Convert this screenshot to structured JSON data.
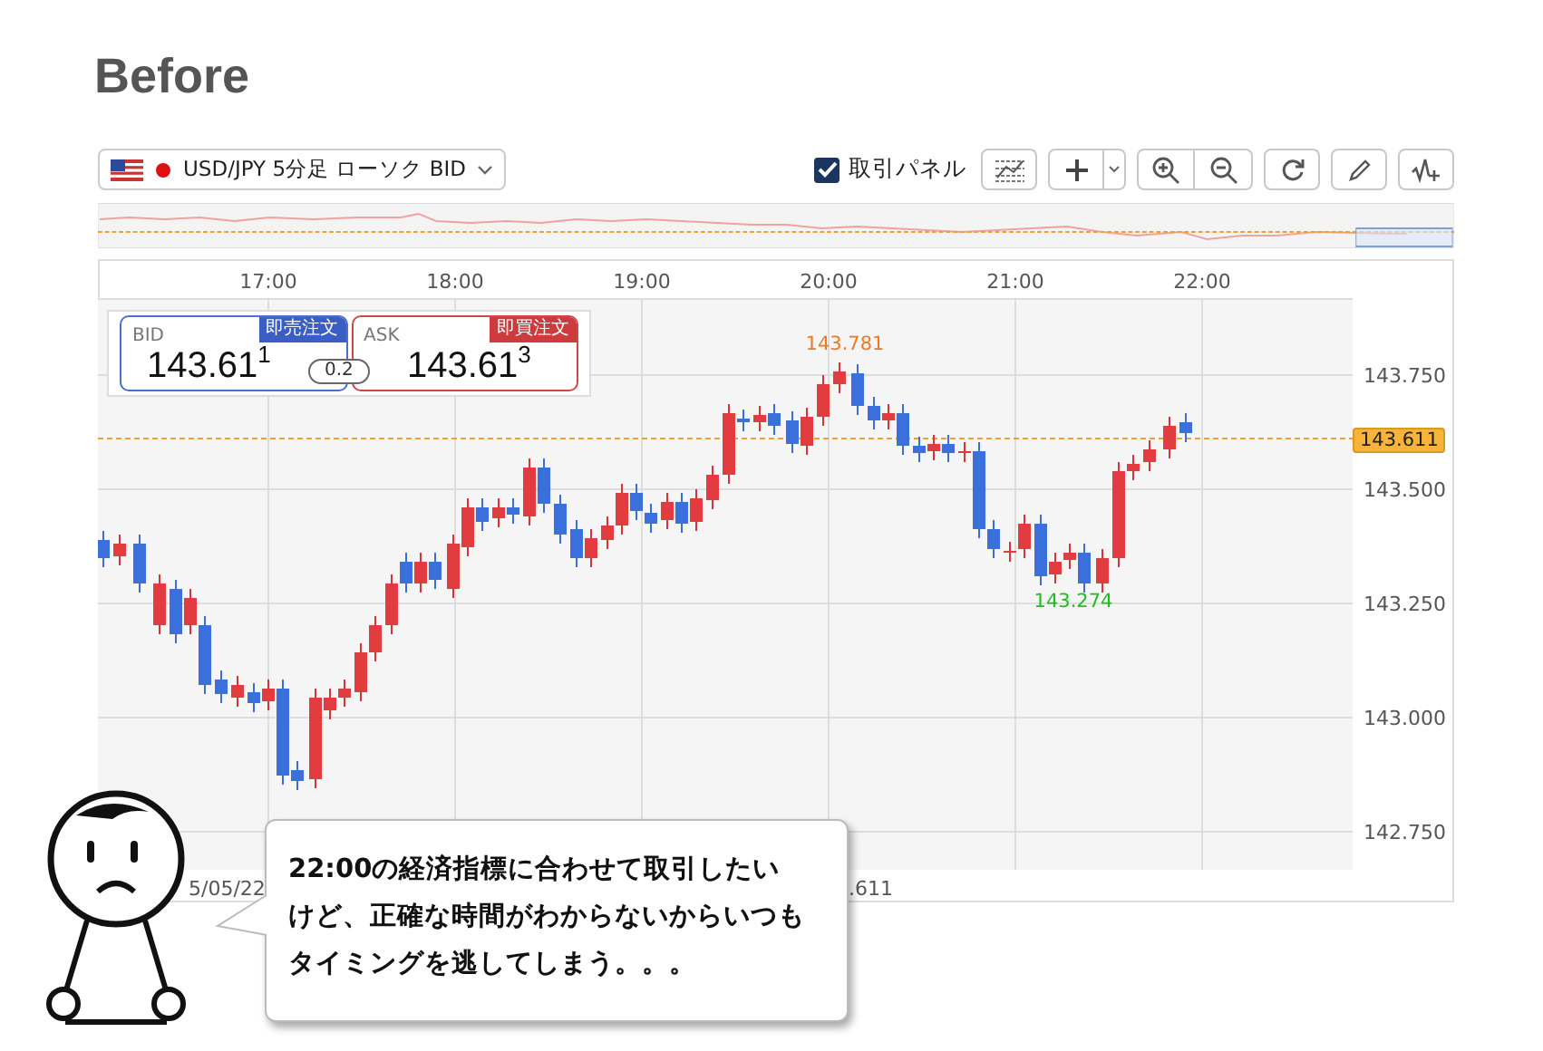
{
  "heading": "Before",
  "toolbar": {
    "symbol_dropdown": {
      "label": "USD/JPY 5分足 ローソク BID"
    },
    "trade_panel_checkbox": {
      "label": "取引パネル",
      "checked": true
    }
  },
  "trade_panel": {
    "bid": {
      "label": "BID",
      "order_button": "即売注文",
      "price": "143.61$^{1}$"
    },
    "spread": "0.2",
    "ask": {
      "label": "ASK",
      "order_button": "即買注文",
      "price": "143.61$^{3}$"
    }
  },
  "chart": {
    "x_axis_labels": [
      "17:00",
      "18:00",
      "19:00",
      "20:00",
      "21:00",
      "22:00"
    ],
    "y_axis_labels": [
      "143.750",
      "143.500",
      "143.250",
      "143.000",
      "142.750"
    ],
    "high_label": "143.781",
    "low_label": "143.274",
    "current_price_tag": "143.611",
    "bottom_labels": [
      "5/05/22",
      ".611"
    ]
  },
  "speech_bubble": {
    "lines": [
      "22:00の経済指標に合わせて取引したい",
      "けど、正確な時間がわからないからいつも",
      "タイミングを逃してしまう。。。"
    ]
  }
}
